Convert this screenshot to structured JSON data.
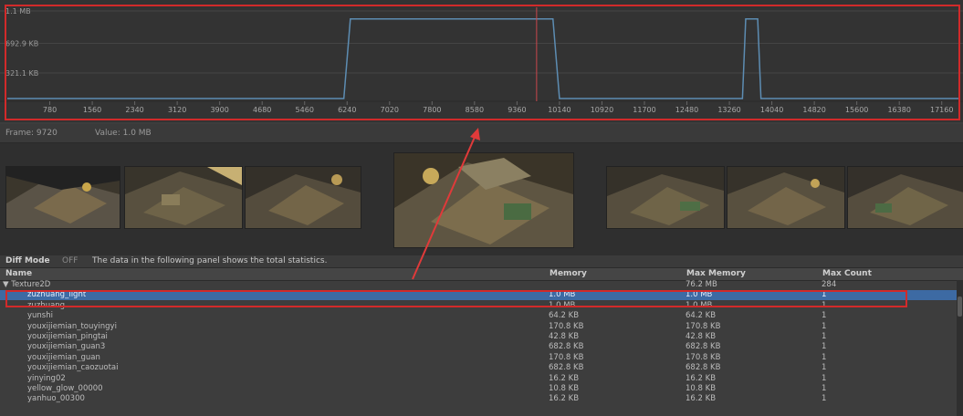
{
  "chart": {
    "y_labels": [
      "1.1 MB",
      "692.9 KB",
      "321.1 KB"
    ],
    "x_ticks": [
      "780",
      "1560",
      "2340",
      "3120",
      "3900",
      "4680",
      "5460",
      "6240",
      "7020",
      "7800",
      "8580",
      "9360",
      "10140",
      "10920",
      "11700",
      "12480",
      "13260",
      "14040",
      "14820",
      "15600",
      "16380",
      "17160"
    ],
    "line_color": "#5d8db3",
    "cursor_color": "#c9474c"
  },
  "chart_data": {
    "type": "line",
    "title": "",
    "xlabel": "",
    "ylabel": "",
    "xlim": [
      0,
      17500
    ],
    "ylim": [
      0,
      1.1
    ],
    "x": [
      0,
      6180,
      6300,
      10020,
      10140,
      13500,
      13560,
      13780,
      13840,
      17500
    ],
    "y": [
      0,
      0,
      1.0,
      1.0,
      0,
      0,
      1.0,
      1.0,
      0,
      0
    ],
    "cursor_x": 9720
  },
  "info": {
    "frame": "Frame: 9720",
    "value": "Value: 1.0 MB"
  },
  "diff": {
    "mode_label": "Diff Mode",
    "mode_state": "OFF",
    "message": "The data in the following panel shows the total statistics."
  },
  "table": {
    "headers": {
      "name": "Name",
      "memory": "Memory",
      "max_memory": "Max Memory",
      "max_count": "Max Count"
    },
    "rows": [
      {
        "name": "▼ Texture2D",
        "memory": "",
        "max_memory": "76.2 MB",
        "max_count": "284",
        "selected": false
      },
      {
        "name": "zuzhuang_light",
        "memory": "1.0 MB",
        "max_memory": "1.0 MB",
        "max_count": "1",
        "selected": true
      },
      {
        "name": "zuzhuang",
        "memory": "1.0 MB",
        "max_memory": "1.0 MB",
        "max_count": "1",
        "selected": false
      },
      {
        "name": "yunshi",
        "memory": "64.2 KB",
        "max_memory": "64.2 KB",
        "max_count": "1",
        "selected": false
      },
      {
        "name": "youxijiemian_touyingyi",
        "memory": "170.8 KB",
        "max_memory": "170.8 KB",
        "max_count": "1",
        "selected": false
      },
      {
        "name": "youxijiemian_pingtai",
        "memory": "42.8 KB",
        "max_memory": "42.8 KB",
        "max_count": "1",
        "selected": false
      },
      {
        "name": "youxijiemian_guan3",
        "memory": "682.8 KB",
        "max_memory": "682.8 KB",
        "max_count": "1",
        "selected": false
      },
      {
        "name": "youxijiemian_guan",
        "memory": "170.8 KB",
        "max_memory": "170.8 KB",
        "max_count": "1",
        "selected": false
      },
      {
        "name": "youxijiemian_caozuotai",
        "memory": "682.8 KB",
        "max_memory": "682.8 KB",
        "max_count": "1",
        "selected": false
      },
      {
        "name": "yinying02",
        "memory": "16.2 KB",
        "max_memory": "16.2 KB",
        "max_count": "1",
        "selected": false
      },
      {
        "name": "yellow_glow_00000",
        "memory": "10.8 KB",
        "max_memory": "10.8 KB",
        "max_count": "1",
        "selected": false
      },
      {
        "name": "yanhuo_00300",
        "memory": "16.2 KB",
        "max_memory": "16.2 KB",
        "max_count": "1",
        "selected": false
      }
    ]
  }
}
